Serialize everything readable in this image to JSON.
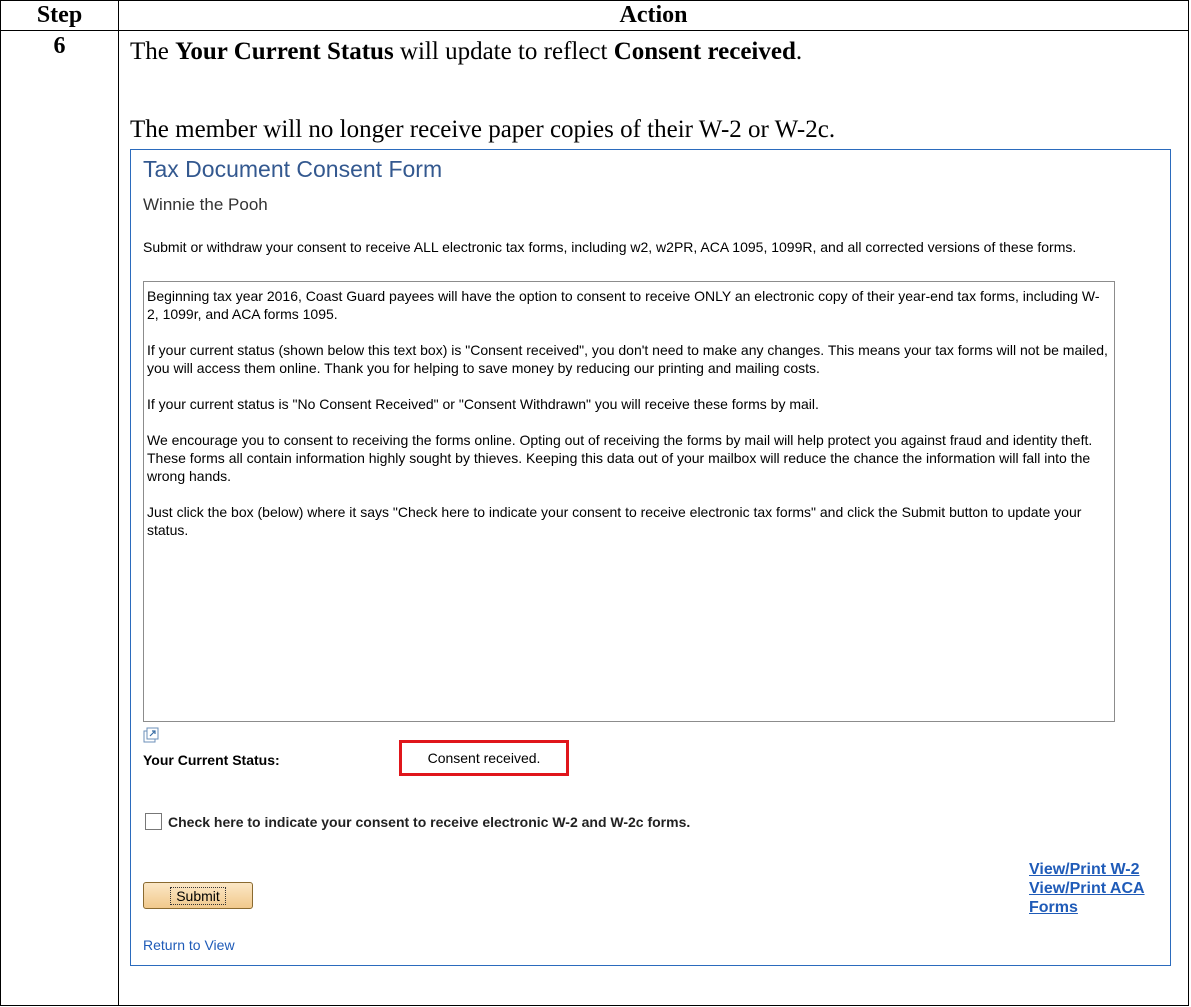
{
  "table": {
    "header_step": "Step",
    "header_action": "Action",
    "step_number": "6"
  },
  "instructions": {
    "line1_prefix": "The ",
    "line1_bold1": "Your Current Status",
    "line1_middle": " will update to reflect ",
    "line1_bold2": "Consent received",
    "line1_suffix": ".",
    "line2": "The member will no longer receive paper copies of their W-2 or W-2c."
  },
  "form": {
    "title": "Tax Document Consent Form",
    "name": "Winnie the Pooh",
    "intro": "Submit or withdraw your consent to receive ALL electronic tax forms, including w2, w2PR, ACA 1095, 1099R, and all corrected versions of these forms.",
    "textbox_paragraphs": [
      "Beginning tax year 2016, Coast Guard payees will have the option to consent to receive ONLY an electronic copy of their year-end tax forms, including W-2, 1099r, and ACA forms 1095.",
      "If your current status (shown below this text box) is \"Consent received\", you don't need to make any changes. This means your tax forms will not be mailed, you will access them online. Thank you for helping to save money by reducing our printing and mailing costs.",
      "If your current status is \"No Consent Received\" or  \"Consent Withdrawn\" you will receive these forms by mail.",
      "We encourage you to consent to receiving the forms online. Opting out of receiving the forms by mail will help protect you against fraud and identity theft. These forms all contain information highly sought by thieves. Keeping this data out of your mailbox will reduce the chance the information will fall into the wrong hands.",
      "Just click the box (below) where it says \"Check here to indicate your consent to receive electronic tax forms\" and click the Submit button to update your status."
    ],
    "status_label": "Your Current Status:",
    "status_value": "Consent received.",
    "consent_label": "Check here to indicate your consent to receive electronic W-2 and W-2c forms.",
    "link_w2": "View/Print W-2",
    "link_aca": "View/Print ACA Forms",
    "submit_label": "Submit",
    "return_label": "Return to View",
    "colors": {
      "title": "#33588f",
      "link": "#1f5bb8",
      "highlight": "#e0161b"
    }
  }
}
